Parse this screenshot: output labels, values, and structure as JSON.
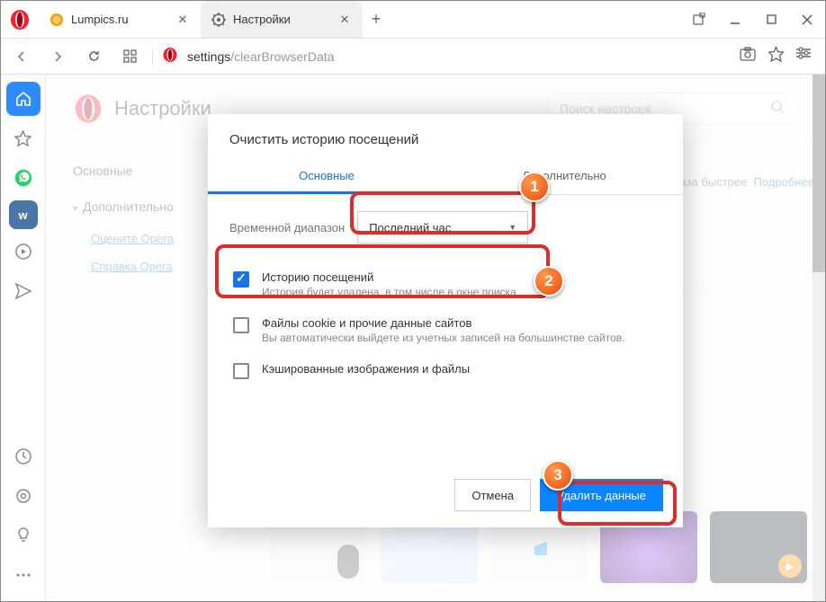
{
  "tabs": {
    "t1": "Lumpics.ru",
    "t2": "Настройки"
  },
  "url": {
    "host": "settings",
    "path": "/clearBrowserData"
  },
  "page": {
    "title": "Настройки",
    "search_placeholder": "Поиск настроек"
  },
  "nav": {
    "basic": "Основные",
    "advanced": "Дополнительно",
    "rate": "Оцените Opera",
    "help": "Справка Opera"
  },
  "banner": {
    "text": "аза быстрее",
    "more": "Подробнее"
  },
  "modal": {
    "title": "Очистить историю посещений",
    "tab_basic": "Основные",
    "tab_adv": "Дополнительно",
    "range_label": "Временной диапазон",
    "range_value": "Последний час",
    "items": [
      {
        "title": "Историю посещений",
        "sub": "История будет удалена, в том числе в окне поиска",
        "checked": true
      },
      {
        "title": "Файлы cookie и прочие данные сайтов",
        "sub": "Вы автоматически выйдете из учетных записей на большинстве сайтов.",
        "checked": false
      },
      {
        "title": "Кэшированные изображения и файлы",
        "sub": "",
        "checked": false
      }
    ],
    "cancel": "Отмена",
    "confirm": "Удалить данные"
  },
  "markers": {
    "m1": "1",
    "m2": "2",
    "m3": "3"
  }
}
